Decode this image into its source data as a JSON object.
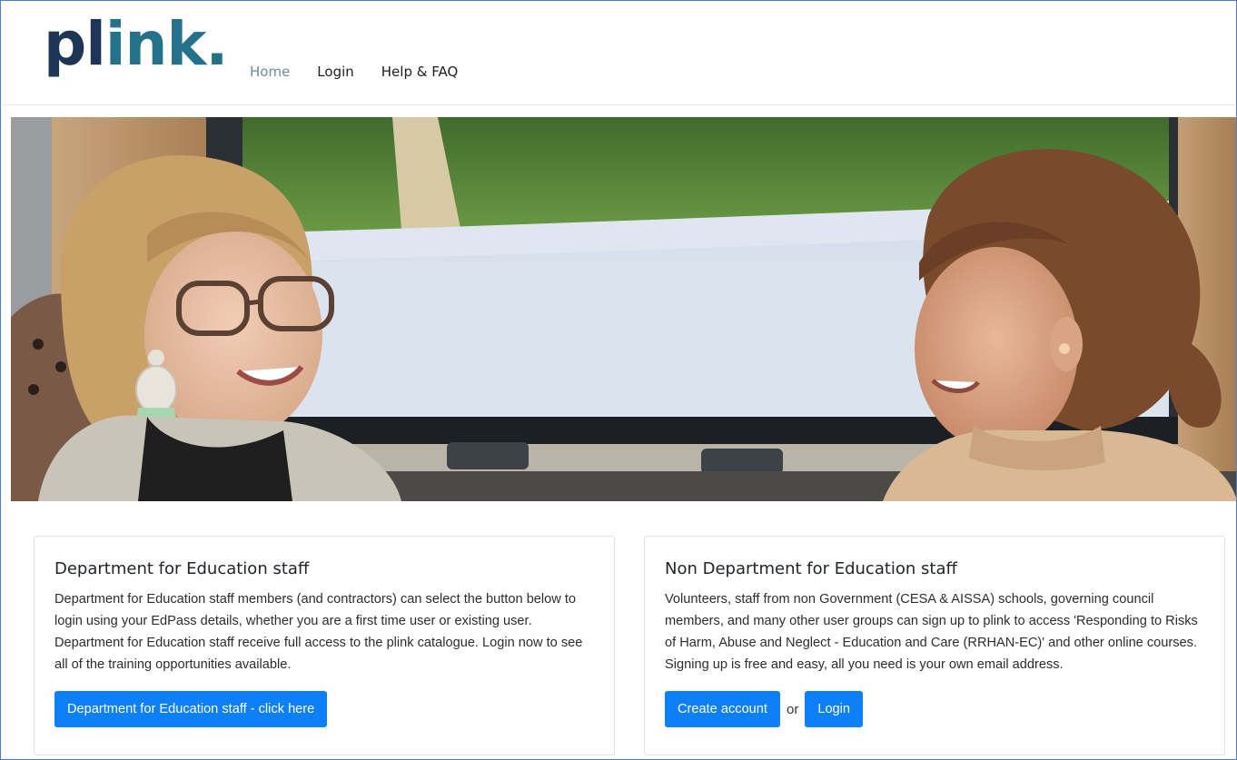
{
  "brand": {
    "logo_part1": "pl",
    "logo_part2": "ink",
    "logo_dot": "."
  },
  "nav": {
    "items": [
      {
        "label": "Home",
        "active": true
      },
      {
        "label": "Login",
        "active": false
      },
      {
        "label": "Help & FAQ",
        "active": false
      }
    ]
  },
  "dfe_card": {
    "title": "Department for Education staff",
    "body": "Department for Education staff members (and contractors) can select the button below to login using your EdPass details, whether you are a first time user or existing user. Department for Education staff receive full access to the plink catalogue. Login now to see all of the training opportunities available.",
    "button_label": "Department for Education staff - click here"
  },
  "non_dfe_card": {
    "title": "Non Department for Education staff",
    "body": "Volunteers, staff from non Government (CESA & AISSA) schools, governing council members, and many other user groups can sign up to plink to access 'Responding to Risks of Harm, Abuse and Neglect - Education and Care (RRHAN-EC)' and other online courses. Signing up is free and easy, all you need is your own email address.",
    "create_label": "Create account",
    "or_text": "or",
    "login_label": "Login"
  },
  "colors": {
    "primary_button": "#0d7ff7",
    "logo_dark": "#1d3557",
    "logo_teal": "#23718a",
    "nav_active": "#6c8ea0"
  }
}
